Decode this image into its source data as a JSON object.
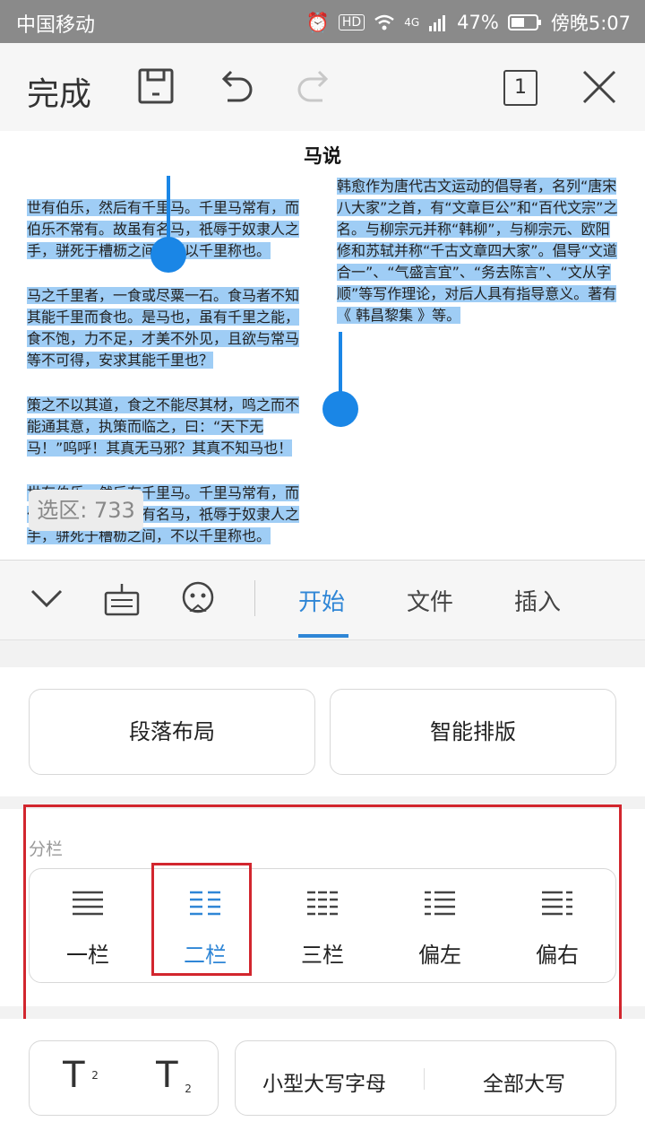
{
  "status_bar": {
    "carrier": "中国移动",
    "network": "4G",
    "battery": "47%",
    "time": "傍晚5:07"
  },
  "toolbar": {
    "done_label": "完成",
    "page_count": "1"
  },
  "document": {
    "title": "马说",
    "left_column": [
      "世有伯乐，然后有千里马。千里马常有，而伯乐不常有。故虽有名马，祇辱于奴隶人之手，骈死于槽枥之间，不以千里称也。",
      "马之千里者，一食或尽粟一石。食马者不知其能千里而食也。是马也，虽有千里之能，食不饱，力不足，才美不外见，且欲与常马等不可得，安求其能千里也？",
      "策之不以其道，食之不能尽其材，鸣之而不能通其意，执策而临之，曰：“天下无马！”呜呼！其真无马邪？其真不知马也！",
      "世有伯乐，然后有千里马。千里马常有，而伯乐不常有。故虽有名马，祇辱于奴隶人之手，骈死于槽枥之间，不以千里称也。"
    ],
    "right_column": "韩愈作为唐代古文运动的倡导者，名列“唐宋八大家”之首，有“文章巨公”和“百代文宗”之名。与柳宗元并称“韩柳”，与柳宗元、欧阳修和苏轼并称“千古文章四大家”。倡导“文道合一”、“气盛言宜”、“务去陈言”、“文从字顺”等写作理论，对后人具有指导意义。著有《 韩昌黎集 》等。",
    "selection_label": "选区: 733"
  },
  "tabs": [
    {
      "label": "开始",
      "active": true
    },
    {
      "label": "文件",
      "active": false
    },
    {
      "label": "插入",
      "active": false
    }
  ],
  "actions": {
    "paragraph_layout": "段落布局",
    "smart_layout": "智能排版"
  },
  "columns_section": {
    "title": "分栏",
    "options": [
      {
        "label": "一栏",
        "selected": false
      },
      {
        "label": "二栏",
        "selected": true
      },
      {
        "label": "三栏",
        "selected": false
      },
      {
        "label": "偏左",
        "selected": false
      },
      {
        "label": "偏右",
        "selected": false
      }
    ]
  },
  "format": {
    "small_caps": "小型大写字母",
    "all_caps": "全部大写",
    "superscript_mark": "2",
    "subscript_mark": "2"
  },
  "colors": {
    "accent": "#2f86d6",
    "selection": "#9fcdf5",
    "highlight_box": "#d2262e"
  }
}
